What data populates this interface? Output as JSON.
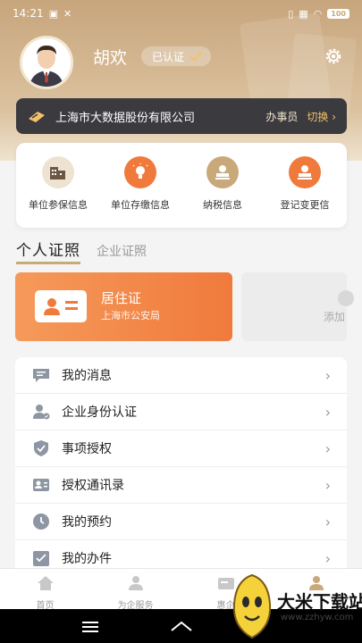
{
  "status_bar": {
    "time": "14:21",
    "battery": "100"
  },
  "profile": {
    "name": "胡欢",
    "verified_label": "已认证"
  },
  "company": {
    "name": "上海市大数据股份有限公司",
    "role": "办事员",
    "switch_label": "切换 ›"
  },
  "services": [
    {
      "label": "单位参保信息",
      "icon": "building-icon",
      "color": "#c9a87a"
    },
    {
      "label": "单位存缴信息",
      "icon": "lightbulb-icon",
      "color": "#f07a3c"
    },
    {
      "label": "纳税信息",
      "icon": "stamp-icon",
      "color": "#c9a87a"
    },
    {
      "label": "登记变更信",
      "icon": "stamp-icon",
      "color": "#f07a3c"
    }
  ],
  "cert_tabs": {
    "active": "个人证照",
    "inactive": "企业证照"
  },
  "certificate": {
    "title": "居住证",
    "issuer": "上海市公安局"
  },
  "add_card": {
    "label": "添加"
  },
  "menu": [
    {
      "label": "我的消息",
      "icon": "message-icon"
    },
    {
      "label": "企业身份认证",
      "icon": "user-verify-icon"
    },
    {
      "label": "事项授权",
      "icon": "shield-check-icon"
    },
    {
      "label": "授权通讯录",
      "icon": "contacts-icon"
    },
    {
      "label": "我的预约",
      "icon": "clock-icon"
    },
    {
      "label": "我的办件",
      "icon": "checklist-icon"
    }
  ],
  "tabbar": [
    {
      "label": "首页",
      "icon": "home-icon"
    },
    {
      "label": "为企服务",
      "icon": "service-icon"
    },
    {
      "label": "惠企",
      "icon": "benefit-icon"
    },
    {
      "label": "",
      "icon": "profile-icon"
    }
  ],
  "watermark": {
    "text": "大米下载站",
    "url": "www.zzhyw.com"
  },
  "colors": {
    "gold": "#c9a87a",
    "orange": "#f07a3c",
    "dark": "#3b3a3f"
  }
}
